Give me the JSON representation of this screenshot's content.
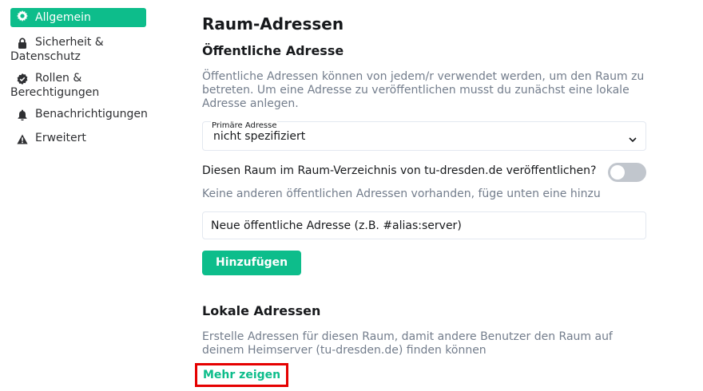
{
  "sidebar": {
    "items": [
      {
        "label": "Allgemein",
        "icon": "gear-icon",
        "active": true
      },
      {
        "label": "Sicherheit & Datenschutz",
        "icon": "lock-icon"
      },
      {
        "label": "Rollen & Berechtigungen",
        "icon": "badge-check-icon"
      },
      {
        "label": "Benachrichtigungen",
        "icon": "bell-icon"
      },
      {
        "label": "Erweitert",
        "icon": "warning-icon"
      }
    ]
  },
  "main": {
    "title": "Raum-Adressen",
    "public_section": {
      "heading": "Öffentliche Adresse",
      "description": "Öffentliche Adressen können von jedem/r verwendet werden, um den Raum zu betreten. Um eine Adresse zu veröffentlichen musst du zunächst eine lokale Adresse anlegen.",
      "select_legend": "Primäre Adresse",
      "select_value": "nicht spezifiziert",
      "publish_label": "Diesen Raum im Raum-Verzeichnis von tu-dresden.de veröffentlichen?",
      "publish_enabled": false,
      "no_other_note": "Keine anderen öffentlichen Adressen vorhanden, füge unten eine hinzu",
      "new_address_placeholder": "Neue öffentliche Adresse (z.B. #alias:server)",
      "add_button": "Hinzufügen"
    },
    "local_section": {
      "heading": "Lokale Adressen",
      "description": "Erstelle Adressen für diesen Raum, damit andere Benutzer den Raum auf deinem Heimserver (tu-dresden.de) finden können",
      "show_more": "Mehr zeigen"
    }
  },
  "colors": {
    "accent": "#0dbd8b",
    "secondary_text": "#737d8c",
    "highlight": "#e50000"
  }
}
